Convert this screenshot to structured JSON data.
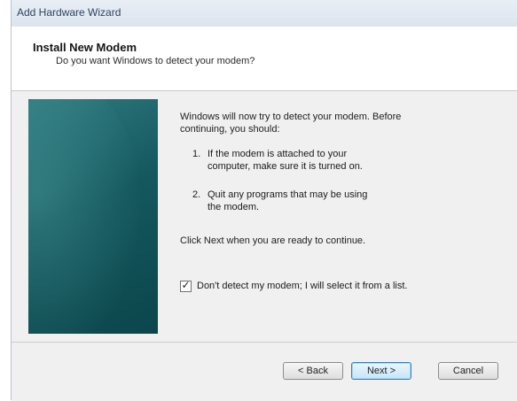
{
  "window": {
    "title": "Add Hardware Wizard"
  },
  "header": {
    "heading": "Install New Modem",
    "subheading": "Do you want Windows to detect your modem?"
  },
  "body": {
    "intro": "Windows will now try to detect your modem. Before continuing, you should:",
    "steps": [
      {
        "number": "1.",
        "text": "If the modem is attached to your computer, make sure it is turned on."
      },
      {
        "number": "2.",
        "text": "Quit any programs that may be using the modem."
      }
    ],
    "instruction": "Click Next when you are ready to continue.",
    "checkbox": {
      "label": "Don't detect my modem; I will select it from a list.",
      "checked": true,
      "mark": "✓"
    }
  },
  "buttons": {
    "back": "< Back",
    "next": "Next >",
    "cancel": "Cancel"
  },
  "colors": {
    "side_panel": "#14585e",
    "title_text": "#30435f",
    "default_button_border": "#3c7fb1"
  }
}
